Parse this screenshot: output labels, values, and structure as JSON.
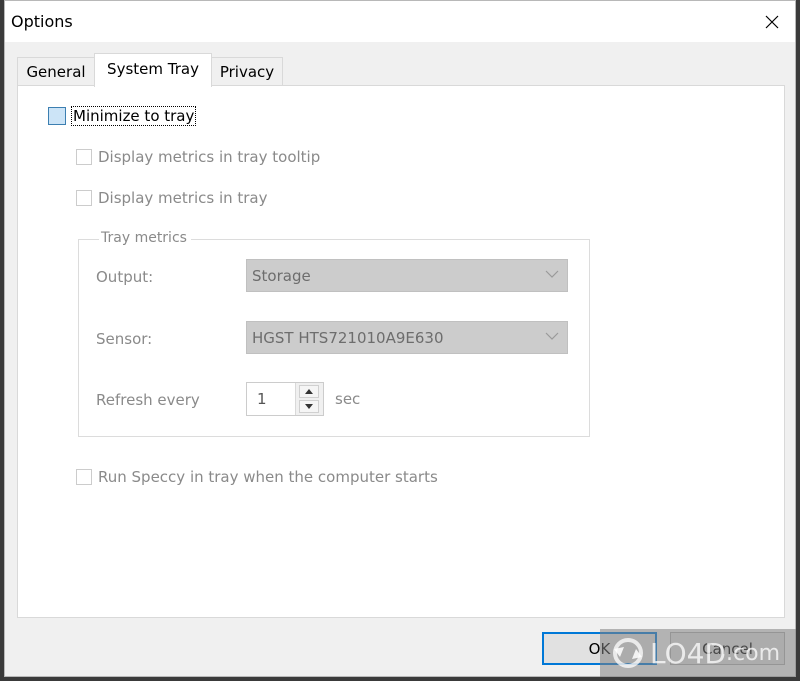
{
  "window": {
    "title": "Options",
    "close_icon": "close-x-icon"
  },
  "tabs": [
    {
      "label": "General",
      "active": false
    },
    {
      "label": "System Tray",
      "active": true
    },
    {
      "label": "Privacy",
      "active": false
    }
  ],
  "system_tray": {
    "minimize_to_tray": {
      "label": "Minimize to tray",
      "checked": false,
      "enabled": true
    },
    "display_tooltip": {
      "label": "Display metrics in tray tooltip",
      "checked": false,
      "enabled": false
    },
    "display_tray": {
      "label": "Display metrics in tray",
      "checked": false,
      "enabled": false
    },
    "tray_metrics": {
      "legend": "Tray metrics",
      "output": {
        "label": "Output:",
        "value": "Storage"
      },
      "sensor": {
        "label": "Sensor:",
        "value": "HGST HTS721010A9E630"
      },
      "refresh": {
        "label": "Refresh every",
        "value": "1",
        "unit": "sec"
      }
    },
    "run_at_startup": {
      "label": "Run Speccy in tray when the computer starts",
      "checked": false,
      "enabled": false
    }
  },
  "buttons": {
    "ok": "OK",
    "cancel": "Cancel"
  },
  "watermark": {
    "brand": "LO4D",
    "suffix": ".com"
  },
  "colors": {
    "accent": "#0078d7",
    "disabled_text": "#8a8a8a",
    "disabled_combo": "#cccccc"
  }
}
